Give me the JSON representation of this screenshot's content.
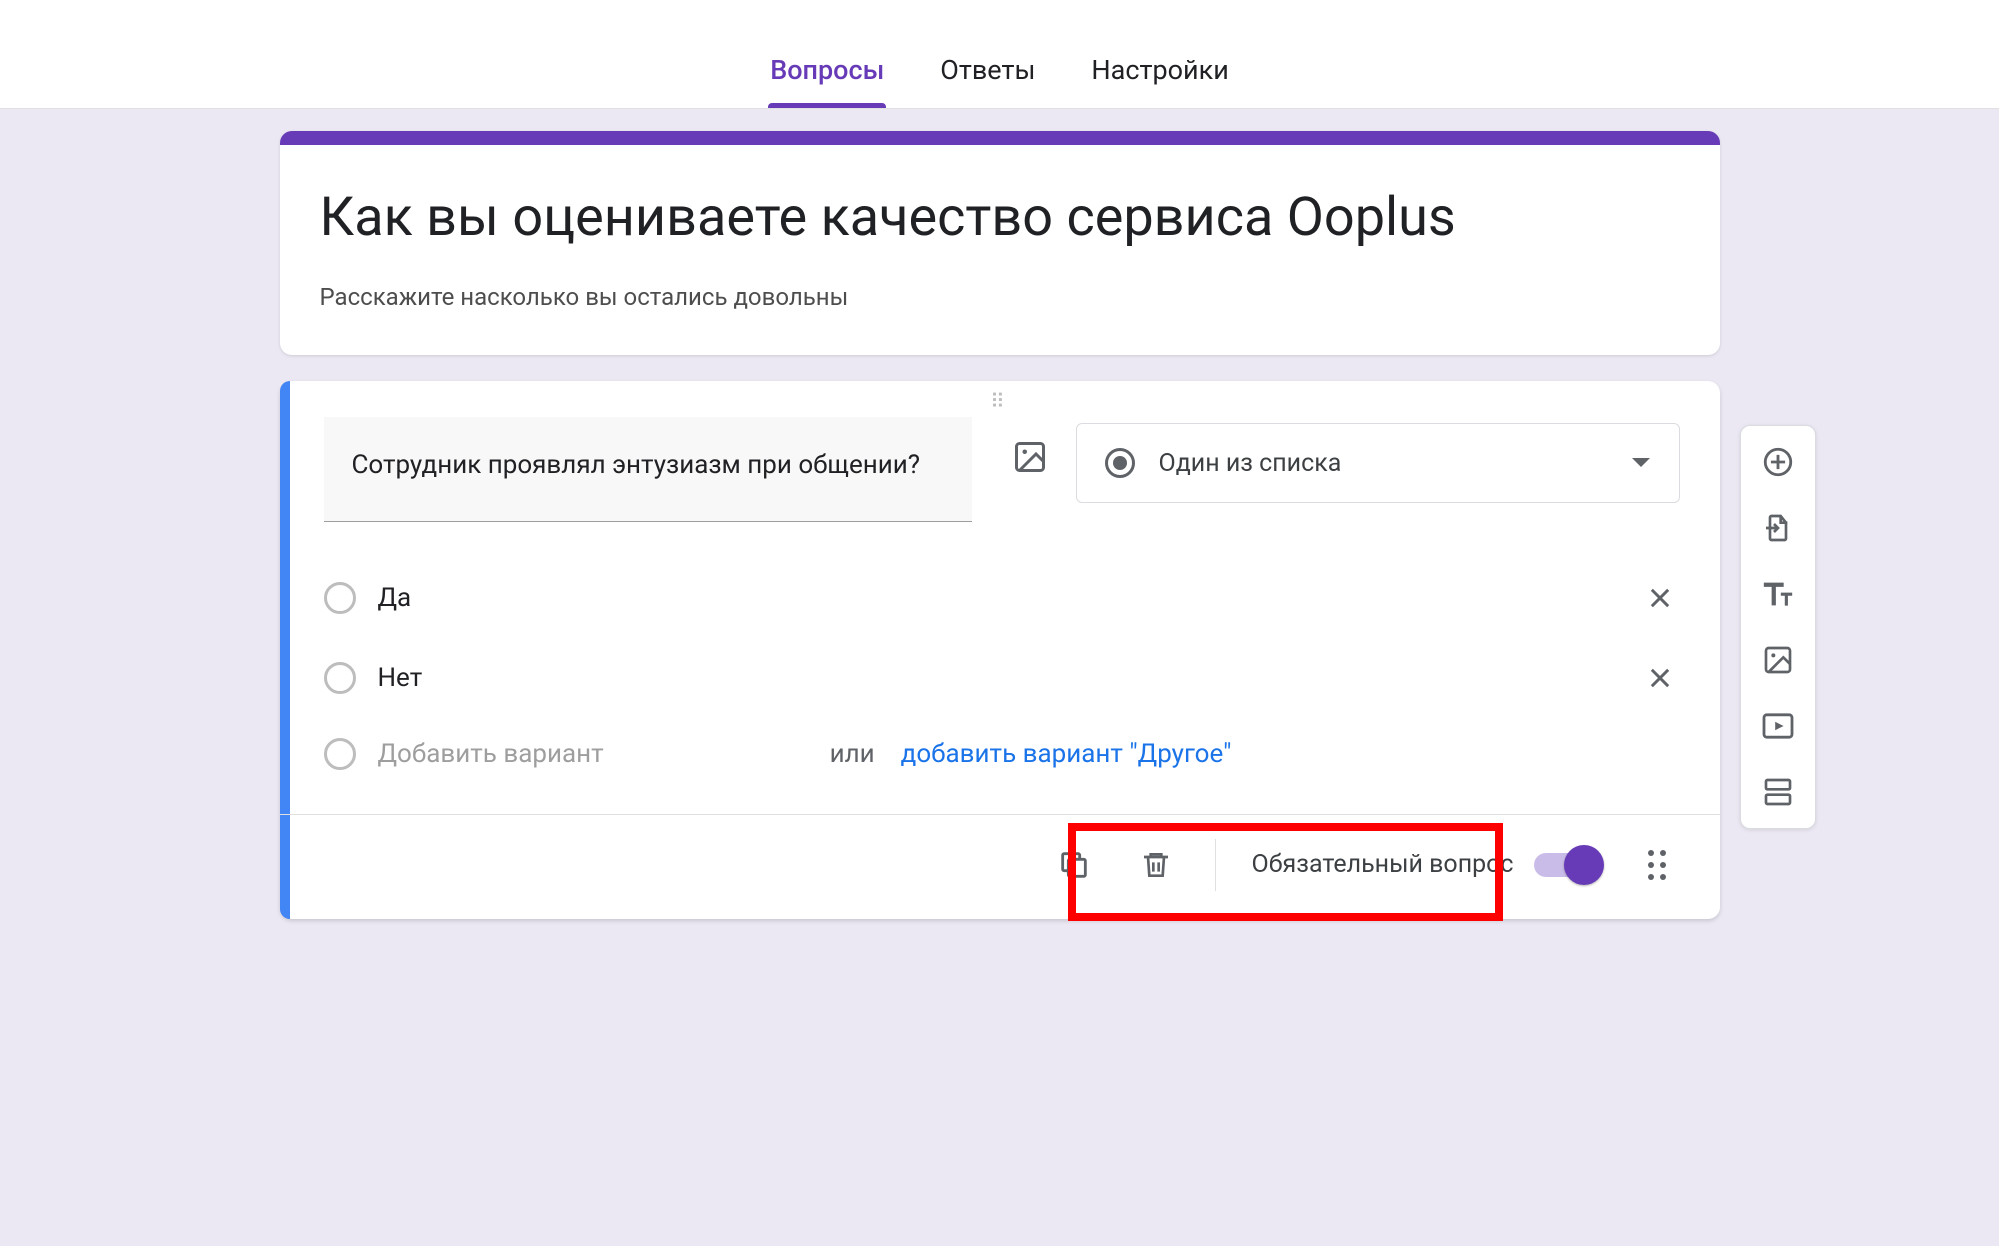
{
  "tabs": {
    "questions": "Вопросы",
    "responses": "Ответы",
    "settings": "Настройки"
  },
  "form": {
    "title": "Как вы оцениваете качество сервиса Ooplus",
    "description": "Расскажите насколько вы остались довольны"
  },
  "question": {
    "title": "Сотрудник проявлял энтузиазм при общении?",
    "type_label": "Один из списка",
    "options": [
      {
        "label": "Да"
      },
      {
        "label": "Нет"
      }
    ],
    "add_option_placeholder": "Добавить вариант",
    "or_text": "или",
    "add_other_link": "добавить вариант \"Другое\"",
    "required_label": "Обязательный вопрос",
    "required_on": true
  },
  "toolbar": {
    "add_question": "add-question",
    "import_questions": "import-questions",
    "add_title": "add-title-description",
    "add_image": "add-image",
    "add_video": "add-video",
    "add_section": "add-section"
  },
  "colors": {
    "accent": "#673ab7",
    "blue_accent": "#4285f4",
    "link": "#1a73e8",
    "highlight": "#ff0000"
  }
}
